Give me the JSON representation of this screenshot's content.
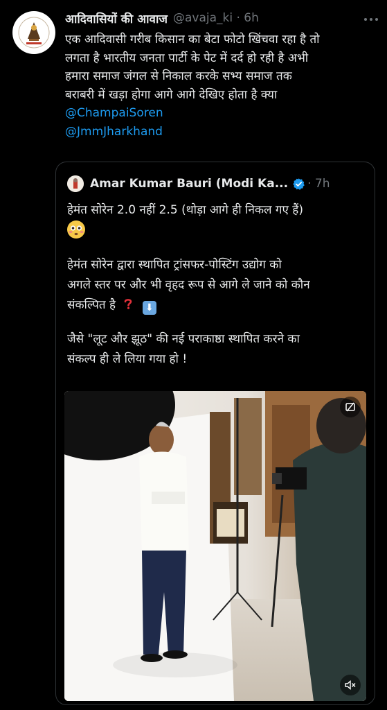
{
  "tweet": {
    "display_name": "आदिवासियों की आवाज",
    "handle_time": "@avaja_ki · 6h",
    "more_icon": "more-horizontal-icon",
    "text_lines": [
      "एक आदिवासी गरीब किसान का बेटा फोटो खिंचवा रहा है तो",
      "लगता है भारतीय जनता पार्टी के पेट में दर्द हो रही है अभी",
      "हमारा समाज जंगल से निकाल करके सभ्य समाज तक",
      "बराबरी में खड़ा होगा आगे आगे देखिए होता है क्या"
    ],
    "mentions": [
      "@ChampaiSoren",
      "@JmmJharkhand"
    ],
    "avatar_label": "Adivasi"
  },
  "quote": {
    "display_name": "Amar Kumar Bauri (Modi Ka...",
    "time": "· 7h",
    "verified_icon": "verified-badge-icon",
    "para1": "हेमंत सोरेन 2.0 नहीं 2.5 (थोड़ा आगे ही निकल गए हैं)",
    "para2_lines": [
      "हेमंत सोरेन द्वारा स्थापित ट्रांसफर-पोस्टिंग उद्योग को",
      "अगले स्तर पर और भी वृहद रूप से आगे ले जाने को कौन",
      "संकल्पित है"
    ],
    "para3_lines": [
      "जैसे \"लूट और झूठ\" की नई पराकाष्ठा स्थापित करने का",
      "संकल्प ही ले लिया गया हो !"
    ],
    "emoji_flushed": "flushed-face-emoji",
    "emoji_question": "red-question-mark-emoji",
    "emoji_down": "down-arrow-emoji",
    "down_glyph": "⬇",
    "media_buttons": {
      "top_right_icon": "media-settings-icon",
      "bottom_right_icon": "mute-volume-icon"
    }
  },
  "colors": {
    "background": "#000000",
    "text": "#e7e9ea",
    "secondary": "#71767b",
    "link": "#1d9bf0",
    "border": "#2f3336",
    "verified": "#1d9bf0"
  }
}
